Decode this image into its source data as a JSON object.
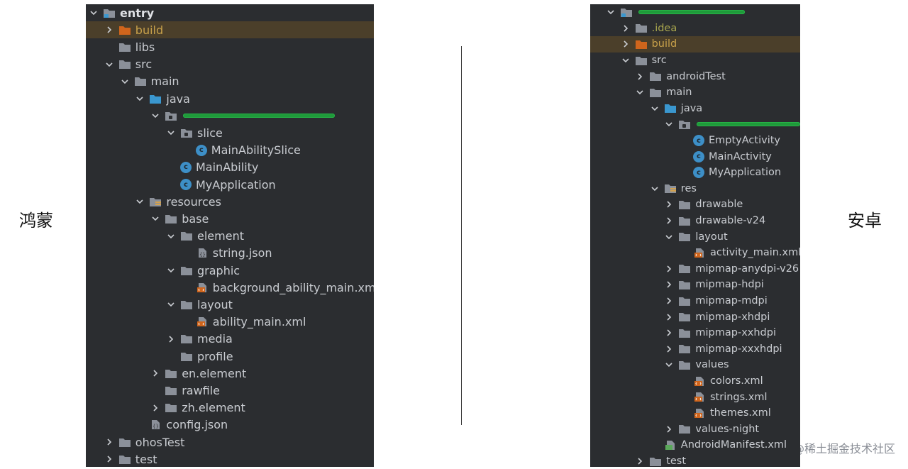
{
  "labels": {
    "left": "鸿蒙",
    "right": "安卓",
    "watermark": "@稀土掘金技术社区"
  },
  "left_tree": [
    {
      "depth": 0,
      "chev": "open",
      "icon": "module",
      "label": "entry",
      "style": "bold"
    },
    {
      "depth": 1,
      "chev": "closed",
      "icon": "folder-orange",
      "label": "build",
      "style": "orange",
      "hl": true
    },
    {
      "depth": 1,
      "chev": "none",
      "icon": "folder",
      "label": "libs"
    },
    {
      "depth": 1,
      "chev": "open",
      "icon": "folder",
      "label": "src"
    },
    {
      "depth": 2,
      "chev": "open",
      "icon": "folder",
      "label": "main"
    },
    {
      "depth": 3,
      "chev": "open",
      "icon": "folder-blue",
      "label": "java"
    },
    {
      "depth": 4,
      "chev": "open",
      "icon": "package",
      "label": "",
      "redacted": true,
      "redact_w": 214
    },
    {
      "depth": 5,
      "chev": "open",
      "icon": "package",
      "label": "slice"
    },
    {
      "depth": 6,
      "chev": "none",
      "icon": "class",
      "label": "MainAbilitySlice"
    },
    {
      "depth": 5,
      "chev": "none",
      "icon": "class",
      "label": "MainAbility"
    },
    {
      "depth": 5,
      "chev": "none",
      "icon": "class",
      "label": "MyApplication"
    },
    {
      "depth": 3,
      "chev": "open",
      "icon": "resources",
      "label": "resources"
    },
    {
      "depth": 4,
      "chev": "open",
      "icon": "folder",
      "label": "base"
    },
    {
      "depth": 5,
      "chev": "open",
      "icon": "folder",
      "label": "element"
    },
    {
      "depth": 6,
      "chev": "none",
      "icon": "json",
      "label": "string.json"
    },
    {
      "depth": 5,
      "chev": "open",
      "icon": "folder",
      "label": "graphic"
    },
    {
      "depth": 6,
      "chev": "none",
      "icon": "xml",
      "label": "background_ability_main.xml"
    },
    {
      "depth": 5,
      "chev": "open",
      "icon": "folder",
      "label": "layout"
    },
    {
      "depth": 6,
      "chev": "none",
      "icon": "xml",
      "label": "ability_main.xml"
    },
    {
      "depth": 5,
      "chev": "closed",
      "icon": "folder",
      "label": "media"
    },
    {
      "depth": 5,
      "chev": "none",
      "icon": "folder",
      "label": "profile"
    },
    {
      "depth": 4,
      "chev": "closed",
      "icon": "folder",
      "label": "en.element"
    },
    {
      "depth": 4,
      "chev": "none",
      "icon": "folder",
      "label": "rawfile"
    },
    {
      "depth": 4,
      "chev": "closed",
      "icon": "folder",
      "label": "zh.element"
    },
    {
      "depth": 3,
      "chev": "none",
      "icon": "json",
      "label": "config.json"
    },
    {
      "depth": 1,
      "chev": "closed",
      "icon": "folder",
      "label": "ohosTest"
    },
    {
      "depth": 1,
      "chev": "closed",
      "icon": "folder",
      "label": "test"
    }
  ],
  "right_tree": [
    {
      "depth": 0,
      "chev": "open",
      "icon": "module",
      "label": "",
      "redacted": true,
      "redact_w": 150
    },
    {
      "depth": 1,
      "chev": "closed",
      "icon": "folder",
      "label": ".idea",
      "style": "olive"
    },
    {
      "depth": 1,
      "chev": "closed",
      "icon": "folder-orange",
      "label": "build",
      "style": "orange",
      "hl": true
    },
    {
      "depth": 1,
      "chev": "open",
      "icon": "folder",
      "label": "src"
    },
    {
      "depth": 2,
      "chev": "closed",
      "icon": "folder",
      "label": "androidTest"
    },
    {
      "depth": 2,
      "chev": "open",
      "icon": "folder",
      "label": "main"
    },
    {
      "depth": 3,
      "chev": "open",
      "icon": "folder-blue",
      "label": "java"
    },
    {
      "depth": 4,
      "chev": "open",
      "icon": "package",
      "label": "",
      "redacted": true,
      "redact_w": 180
    },
    {
      "depth": 5,
      "chev": "none",
      "icon": "class",
      "label": "EmptyActivity"
    },
    {
      "depth": 5,
      "chev": "none",
      "icon": "class",
      "label": "MainActivity"
    },
    {
      "depth": 5,
      "chev": "none",
      "icon": "class",
      "label": "MyApplication"
    },
    {
      "depth": 3,
      "chev": "open",
      "icon": "resources",
      "label": "res"
    },
    {
      "depth": 4,
      "chev": "closed",
      "icon": "folder",
      "label": "drawable"
    },
    {
      "depth": 4,
      "chev": "closed",
      "icon": "folder",
      "label": "drawable-v24"
    },
    {
      "depth": 4,
      "chev": "open",
      "icon": "folder",
      "label": "layout"
    },
    {
      "depth": 5,
      "chev": "none",
      "icon": "xml",
      "label": "activity_main.xml"
    },
    {
      "depth": 4,
      "chev": "closed",
      "icon": "folder",
      "label": "mipmap-anydpi-v26"
    },
    {
      "depth": 4,
      "chev": "closed",
      "icon": "folder",
      "label": "mipmap-hdpi"
    },
    {
      "depth": 4,
      "chev": "closed",
      "icon": "folder",
      "label": "mipmap-mdpi"
    },
    {
      "depth": 4,
      "chev": "closed",
      "icon": "folder",
      "label": "mipmap-xhdpi"
    },
    {
      "depth": 4,
      "chev": "closed",
      "icon": "folder",
      "label": "mipmap-xxhdpi"
    },
    {
      "depth": 4,
      "chev": "closed",
      "icon": "folder",
      "label": "mipmap-xxxhdpi"
    },
    {
      "depth": 4,
      "chev": "open",
      "icon": "folder",
      "label": "values"
    },
    {
      "depth": 5,
      "chev": "none",
      "icon": "xml",
      "label": "colors.xml"
    },
    {
      "depth": 5,
      "chev": "none",
      "icon": "xml",
      "label": "strings.xml"
    },
    {
      "depth": 5,
      "chev": "none",
      "icon": "xml",
      "label": "themes.xml"
    },
    {
      "depth": 4,
      "chev": "closed",
      "icon": "folder",
      "label": "values-night"
    },
    {
      "depth": 3,
      "chev": "none",
      "icon": "manifest",
      "label": "AndroidManifest.xml"
    },
    {
      "depth": 2,
      "chev": "closed",
      "icon": "folder",
      "label": "test"
    }
  ]
}
